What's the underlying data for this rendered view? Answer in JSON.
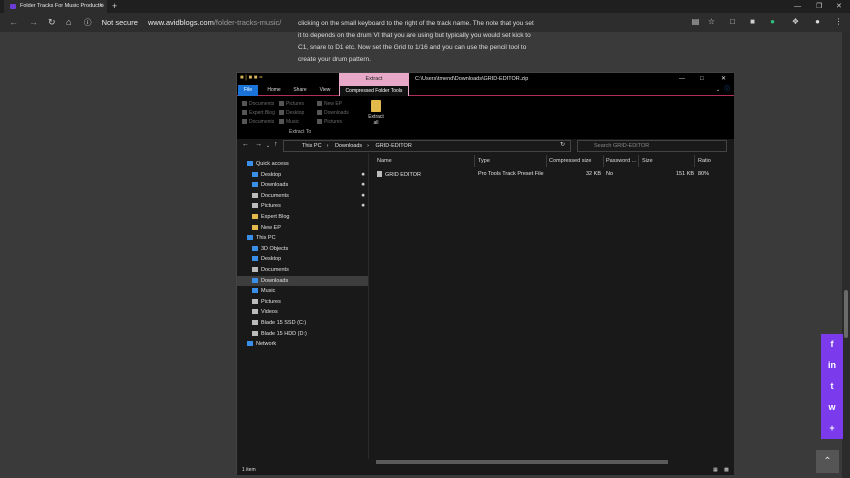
{
  "browser": {
    "tab_title": "Folder Tracks For Music Productio",
    "tab_close": "×",
    "new_tab": "+",
    "security": "Not secure",
    "url_host": "www.avidblogs.com",
    "url_path": "/folder-tracks-music/"
  },
  "article": {
    "line1": "clicking on the small keyboard to the right of the track name. The note that you set",
    "line2": "it to depends on the drum VI that you are using but typically you would set kick to",
    "line3": "C1, snare to D1 etc. Now set the Grid to 1/16 and you can use the pencil tool to",
    "line4": "create your drum pattern."
  },
  "explorer": {
    "context_tab": "Extract",
    "title": "C:\\Users\\tmend\\Downloads\\GRID-EDITOR.zip",
    "tabs": {
      "file": "File",
      "home": "Home",
      "share": "Share",
      "view": "View",
      "cfs": "Compressed Folder Tools"
    },
    "ribbon": {
      "col1": [
        "Documents",
        "Expert Blog",
        "Documents"
      ],
      "col2": [
        "Pictures",
        "Desktop",
        "Music"
      ],
      "col3": [
        "New EP",
        "Downloads",
        "Pictures"
      ],
      "extract_all_1": "Extract",
      "extract_all_2": "all",
      "extract_to": "Extract To"
    },
    "path": [
      "This PC",
      "Downloads",
      "GRID-EDITOR"
    ],
    "search_placeholder": "Search GRID-EDITOR",
    "nav": {
      "quick_access": "Quick access",
      "qa_items": [
        "Desktop",
        "Downloads",
        "Documents",
        "Pictures",
        "Expert Blog",
        "New EP"
      ],
      "this_pc": "This PC",
      "pc_items": [
        "3D Objects",
        "Desktop",
        "Documents",
        "Downloads",
        "Music",
        "Pictures",
        "Videos",
        "Blade 15 SSD (C:)",
        "Blade 15 HDD (D:)"
      ],
      "network": "Network"
    },
    "columns": [
      "Name",
      "Type",
      "Compressed size",
      "Password ...",
      "Size",
      "Ratio"
    ],
    "file": {
      "name": "GRID EDITOR",
      "type": "Pro Tools Track Preset File",
      "compressed": "32 KB",
      "password": "No",
      "size": "151 KB",
      "ratio": "80%"
    },
    "status": "1 item"
  },
  "social": [
    "f",
    "in",
    "t",
    "w",
    "+"
  ],
  "colors": {
    "share_bar": "#7c3aed",
    "file_tab": "#1a73d8",
    "extract_tag": "#e8a9c8"
  }
}
